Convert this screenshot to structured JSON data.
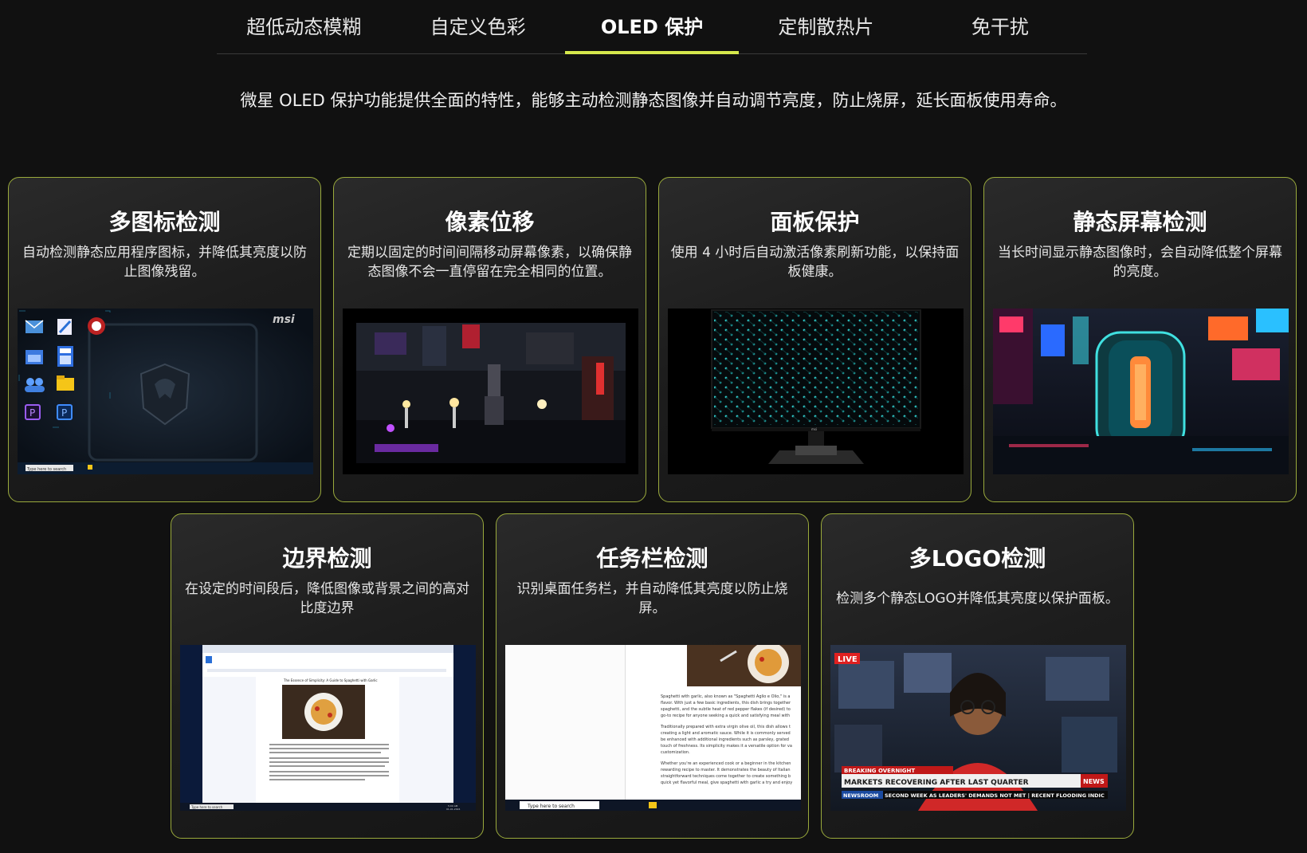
{
  "tabs": [
    {
      "label": "超低动态模糊"
    },
    {
      "label": "自定义色彩"
    },
    {
      "label": "OLED 保护"
    },
    {
      "label": "定制散热片"
    },
    {
      "label": "免干扰"
    }
  ],
  "intro": "微星 OLED 保护功能提供全面的特性，能够主动检测静态图像并自动调节亮度，防止烧屏，延长面板使用寿命。",
  "cards": [
    {
      "title": "多图标检测",
      "desc": "自动检测静态应用程序图标，并降低其亮度以防止图像残留。"
    },
    {
      "title": "像素位移",
      "desc": "定期以固定的时间间隔移动屏幕像素，以确保静态图像不会一直停留在完全相同的位置。"
    },
    {
      "title": "面板保护",
      "desc": "使用 4 小时后自动激活像素刷新功能，以保持面板健康。"
    },
    {
      "title": "静态屏幕检测",
      "desc": "当长时间显示静态图像时，会自动降低整个屏幕的亮度。"
    },
    {
      "title": "边界检测",
      "desc": "在设定的时间段后，降低图像或背景之间的高对比度边界"
    },
    {
      "title": "任务栏检测",
      "desc": "识别桌面任务栏，并自动降低其亮度以防止烧屏。"
    },
    {
      "title": "多LOGO检测",
      "desc": "检测多个静态LOGO并降低其亮度以保护面板。"
    }
  ],
  "images": {
    "desktop": {
      "brand": "msi",
      "search": "Type here to search"
    },
    "docs": {
      "doc_title": "The Essence of Simplicity: A Guide to Spaghetti with Garlic",
      "search": "Type here to search",
      "time": "5:00 AM",
      "date": "01-01-2024"
    },
    "taskbar": {
      "search": "Type here to search",
      "p1": "Spaghetti with garlic, also known as \"Spaghetti Aglio e Olio,\" is a",
      "p1b": "flavor. With just a few basic ingredients, this dish brings together",
      "p1c": "spaghetti, and the subtle heat of red pepper flakes (if desired) to",
      "p1d": "go-to recipe for anyone seeking a quick and satisfying meal with",
      "p2": "Traditionally prepared with extra virgin olive oil, this dish allows t",
      "p2b": "creating a light and aromatic sauce. While it is commonly served",
      "p2c": "be enhanced with additional ingredients such as parsley, grated",
      "p2d": "touch of freshness. Its simplicity makes it a versatile option for va",
      "p2e": "customization.",
      "p3": "Whether you're an experienced cook or a beginner in the kitchen",
      "p3b": "rewarding recipe to master. It demonstrates the beauty of Italian",
      "p3c": "straightforward techniques come together to create something b",
      "p3d": "quick yet flavorful meal, give spaghetti with garlic a try and enjoy"
    },
    "news": {
      "live": "LIVE",
      "breaking": "BREAKING OVERNIGHT",
      "headline": "MARKETS RECOVERING AFTER LAST QUARTER",
      "news_badge": "NEWS",
      "ticker_label": "NEWSROOM",
      "ticker": "SECOND WEEK AS LEADERS' DEMANDS NOT MET  |  RECENT FLOODING INDIC"
    }
  },
  "colors": {
    "accent": "#d6e84c",
    "card_border": "#9aaa3c",
    "background": "#111111"
  }
}
